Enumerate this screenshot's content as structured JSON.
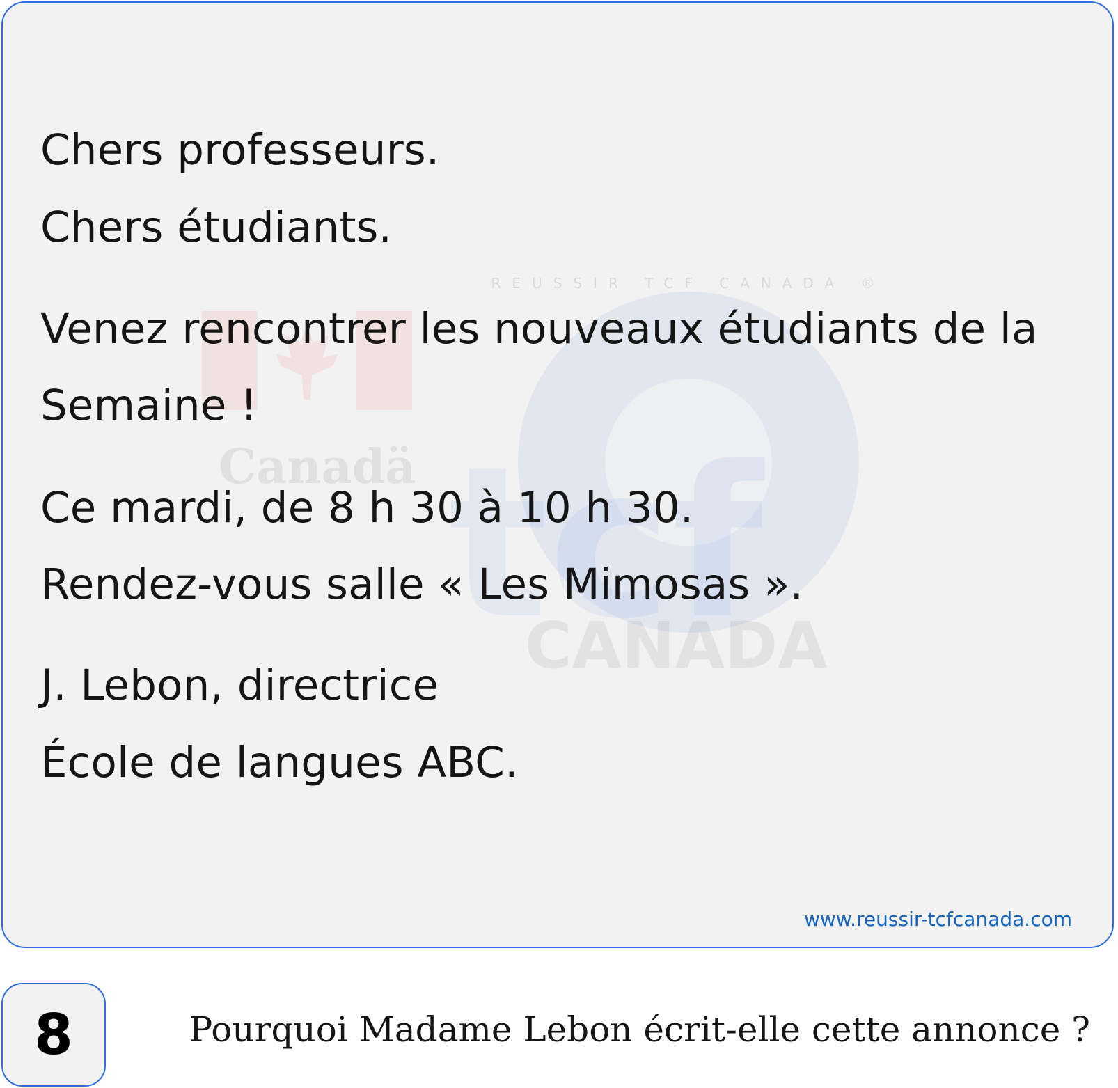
{
  "notice": {
    "greeting_1": "Chers professeurs.",
    "greeting_2": "Chers étudiants.",
    "body_line_1": "Venez rencontrer les nouveaux étudiants de la",
    "body_line_2": "Semaine !",
    "schedule": "Ce mardi, de 8 h 30 à 10 h 30.",
    "location": "Rendez-vous salle « Les Mimosas ».",
    "signature_name": "J. Lebon, directrice",
    "signature_org": "École de langues ABC.",
    "website": "www.reussir-tcfcanada.com"
  },
  "watermark": {
    "canada_wordmark": "Canadä",
    "logo_letters": "tcf",
    "logo_country": "CANADA",
    "ring_text": "REUSSIR TCF CANADA ®",
    "colors": {
      "flag_red": "#e11c1c",
      "logo_blue": "#1f66d9"
    }
  },
  "question": {
    "number": "8",
    "text": "Pourquoi Madame Lebon écrit-elle cette annonce ?"
  },
  "colors": {
    "card_border": "#2f6fdc",
    "card_background": "#f2f2f2",
    "link": "#1565c0",
    "text": "#151515"
  }
}
